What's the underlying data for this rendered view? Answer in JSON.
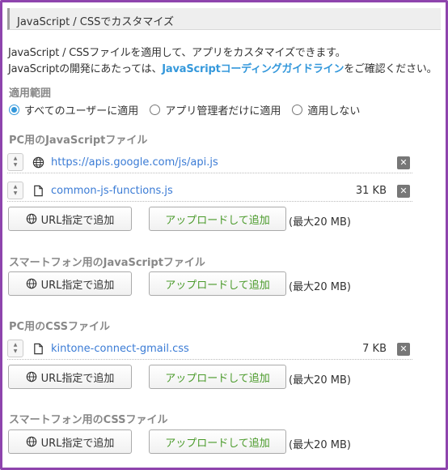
{
  "header": {
    "title": "JavaScript / CSSでカスタマイズ"
  },
  "description": {
    "line1": "JavaScript / CSSファイルを適用して、アプリをカスタマイズできます。",
    "line2_prefix": "JavaScriptの開発にあたっては、",
    "line2_link": "JavaScriptコーディングガイドライン",
    "line2_suffix": "をご確認ください。"
  },
  "scope": {
    "label": "適用範囲",
    "options": [
      {
        "label": "すべてのユーザーに適用",
        "checked": true
      },
      {
        "label": "アプリ管理者だけに適用",
        "checked": false
      },
      {
        "label": "適用しない",
        "checked": false
      }
    ]
  },
  "common": {
    "url_button": "URL指定で追加",
    "upload_button": "アップロードして追加",
    "max_size": "(最大20 MB)"
  },
  "sections": {
    "pc_js": {
      "title": "PC用のJavaScriptファイル",
      "files": [
        {
          "icon": "globe-icon",
          "name": "https://apis.google.com/js/api.js",
          "size": ""
        },
        {
          "icon": "file-icon",
          "name": "common-js-functions.js",
          "size": "31 KB"
        }
      ]
    },
    "sp_js": {
      "title": "スマートフォン用のJavaScriptファイル",
      "files": []
    },
    "pc_css": {
      "title": "PC用のCSSファイル",
      "files": [
        {
          "icon": "file-icon",
          "name": "kintone-connect-gmail.css",
          "size": "7 KB"
        }
      ]
    },
    "sp_css": {
      "title": "スマートフォン用のCSSファイル",
      "files": []
    }
  },
  "colors": {
    "accent": "#3498db",
    "upload_text": "#4a9a2a",
    "frame": "#8e44ad"
  }
}
